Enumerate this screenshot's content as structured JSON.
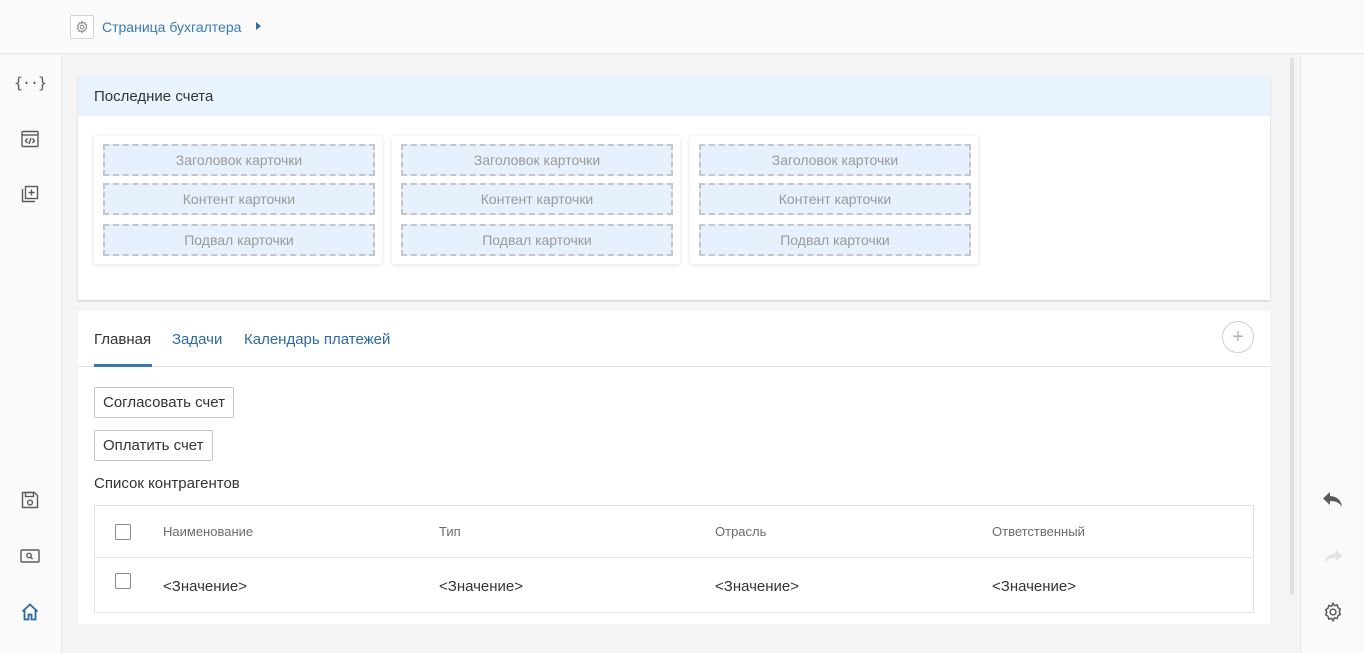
{
  "breadcrumb": {
    "label": "Страница бухгалтера"
  },
  "left_sidebar": {
    "icons": [
      "code-braces-icon",
      "code-window-icon",
      "add-widget-icon",
      "save-icon",
      "search-panel-icon",
      "home-icon"
    ],
    "braces_text": "{··}"
  },
  "right_sidebar": {
    "icons": [
      "undo-icon",
      "redo-icon",
      "settings-icon"
    ]
  },
  "recent_invoices": {
    "title": "Последние счета",
    "cards": [
      {
        "header": "Заголовок карточки",
        "content": "Контент карточки",
        "footer": "Подвал карточки"
      },
      {
        "header": "Заголовок карточки",
        "content": "Контент карточки",
        "footer": "Подвал карточки"
      },
      {
        "header": "Заголовок карточки",
        "content": "Контент карточки",
        "footer": "Подвал карточки"
      }
    ]
  },
  "tabs": [
    {
      "label": "Главная",
      "active": true
    },
    {
      "label": "Задачи",
      "active": false
    },
    {
      "label": "Календарь платежей",
      "active": false
    }
  ],
  "add_tab_symbol": "+",
  "actions": {
    "approve": "Согласовать счет",
    "pay": "Оплатить счет"
  },
  "counterparties": {
    "title": "Список контрагентов",
    "columns": [
      "Наименование",
      "Тип",
      "Отрасль",
      "Ответственный"
    ],
    "rows": [
      [
        "<Значение>",
        "<Значение>",
        "<Значение>",
        "<Значение>"
      ]
    ]
  },
  "colors": {
    "accent": "#3a7ab3",
    "header_bg": "#e9f3fd",
    "slot_bg": "#e6f1fd"
  }
}
